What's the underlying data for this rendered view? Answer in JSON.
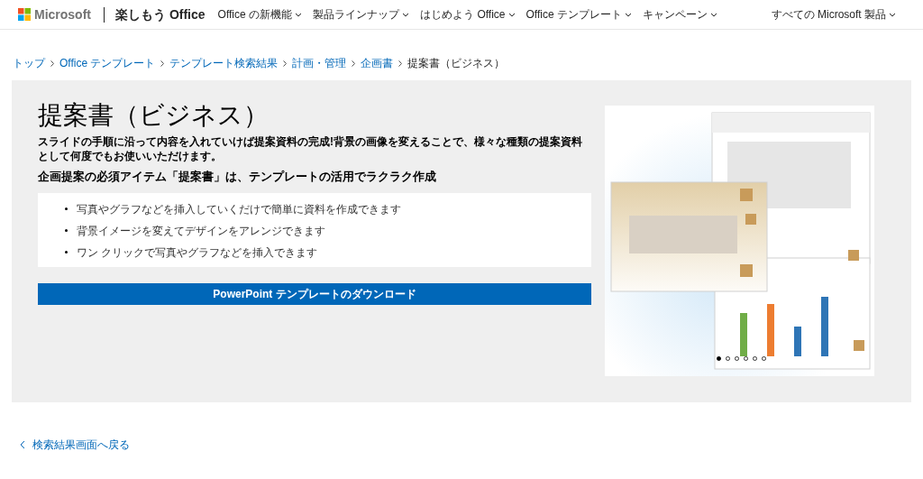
{
  "header": {
    "brand": "Microsoft",
    "site": "楽しもう Office",
    "nav": [
      {
        "label": "Office の新機能"
      },
      {
        "label": "製品ラインナップ"
      },
      {
        "label": "はじめよう Office"
      },
      {
        "label": "Office テンプレート"
      },
      {
        "label": "キャンペーン"
      }
    ],
    "all_products": "すべての Microsoft 製品"
  },
  "breadcrumb": [
    {
      "label": "トップ",
      "link": true
    },
    {
      "label": "Office テンプレート",
      "link": true
    },
    {
      "label": "テンプレート検索結果",
      "link": true
    },
    {
      "label": "計画・管理",
      "link": true
    },
    {
      "label": "企画書",
      "link": true
    },
    {
      "label": "提案書（ビジネス）",
      "link": false
    }
  ],
  "hero": {
    "title": "提案書（ビジネス）",
    "description": "スライドの手順に沿って内容を入れていけば提案資料の完成!背景の画像を変えることで、様々な種類の提案資料として何度でもお使いいただけます。",
    "subtitle": "企画提案の必須アイテム「提案書」は、テンプレートの活用でラクラク作成",
    "features": [
      "写真やグラフなどを挿入していくだけで簡単に資料を作成できます",
      "背景イメージを変えてデザインをアレンジできます",
      "ワン クリックで写真やグラフなどを挿入できます"
    ],
    "download_button": "PowerPoint テンプレートのダウンロード",
    "preview": {
      "kind": "picture",
      "dots": [
        {
          "selected": true
        },
        {
          "selected": false
        },
        {
          "selected": false
        },
        {
          "selected": false
        },
        {
          "selected": false
        },
        {
          "selected": false
        }
      ]
    }
  },
  "back_link": "検索結果画面へ戻る"
}
